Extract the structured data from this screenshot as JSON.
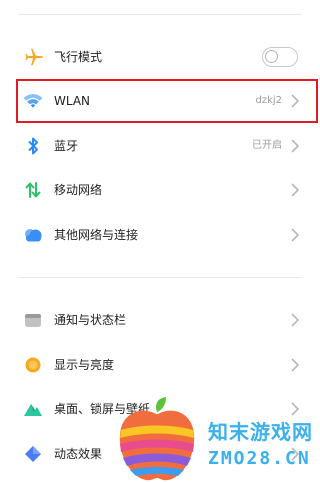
{
  "colors": {
    "airplane": "#f5a623",
    "wifi": "#2b8cf7",
    "bluetooth": "#2b8cf7",
    "mobile_network": "#27c26a",
    "other_networks": "#3a8ef6",
    "notification_bar": "#9a9a9a",
    "display": "#f7a81c",
    "wallpaper": "#2cc6a0",
    "effects": "#4a7cf2",
    "highlight": "#e11c24",
    "watermark": "#3bb0ee"
  },
  "section1": {
    "airplane": {
      "label": "飞行模式",
      "icon": "airplane-icon",
      "toggle_on": false
    },
    "wlan": {
      "label": "WLAN",
      "value": "dzkj2",
      "icon": "wifi-icon"
    },
    "bluetooth": {
      "label": "蓝牙",
      "value": "已开启",
      "icon": "bluetooth-icon"
    },
    "mobile": {
      "label": "移动网络",
      "icon": "mobile-network-icon"
    },
    "other": {
      "label": "其他网络与连接",
      "icon": "cloud-icon"
    }
  },
  "section2": {
    "notification": {
      "label": "通知与状态栏",
      "icon": "status-bar-icon"
    },
    "display": {
      "label": "显示与亮度",
      "icon": "brightness-icon"
    },
    "wallpaper": {
      "label": "桌面、锁屏与壁纸",
      "icon": "wallpaper-icon"
    },
    "effects": {
      "label": "动态效果",
      "icon": "effects-icon"
    }
  },
  "watermark": {
    "line1": "知末游戏网",
    "line2": "ZMO28.CN"
  }
}
